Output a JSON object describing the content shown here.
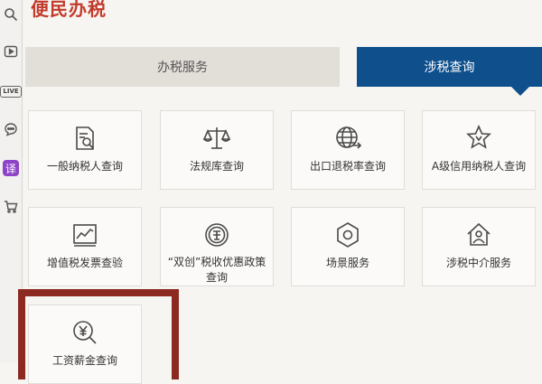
{
  "page": {
    "title": "便民办税"
  },
  "tabs": [
    {
      "label": "办税服务",
      "selected": false
    },
    {
      "label": "涉税查询",
      "selected": true
    }
  ],
  "services": [
    {
      "label": "一般纳税人查询",
      "icon": "document-search-icon"
    },
    {
      "label": "法规库查询",
      "icon": "scales-icon"
    },
    {
      "label": "出口退税率查询",
      "icon": "globe-arrow-icon"
    },
    {
      "label": "A级信用纳税人查询",
      "icon": "star-badge-icon"
    },
    {
      "label": "增值税发票查验",
      "icon": "chart-frame-icon"
    },
    {
      "label": "“双创”税收优惠政策查询",
      "icon": "coin-icon"
    },
    {
      "label": "场景服务",
      "icon": "hexagon-icon"
    },
    {
      "label": "涉税中介服务",
      "icon": "house-person-icon"
    },
    {
      "label": "工资薪金查询",
      "icon": "yen-search-icon"
    }
  ],
  "sidebar": {
    "live_label": "LIVE",
    "translate_label": "译"
  },
  "colors": {
    "accent": "#0e4f8c",
    "title": "#c23a2b",
    "highlight": "#8c2a22"
  }
}
